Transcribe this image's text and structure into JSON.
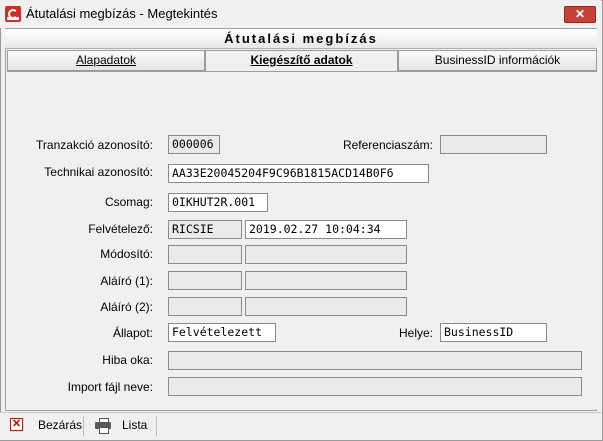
{
  "window": {
    "title": "Átutalási megbízás - Megtekintés",
    "close_glyph": "✕"
  },
  "form": {
    "title": "Átutalási megbízás"
  },
  "tabs": [
    {
      "label": "Alapadatok",
      "active": false
    },
    {
      "label": "Kiegészítő adatok",
      "active": true
    },
    {
      "label": "BusinessID információk",
      "active": false
    }
  ],
  "fields": {
    "tranzakcio": {
      "label": "Tranzakció azonosító:",
      "value": "000006"
    },
    "referencia": {
      "label": "Referenciaszám:",
      "value": ""
    },
    "technikai": {
      "label": "Technikai azonosító:",
      "value": "AA33E20045204F9C96B1815ACD14B0F6"
    },
    "csomag": {
      "label": "Csomag:",
      "value": "0IKHUT2R.001"
    },
    "felvetelezo": {
      "label": "Felvételező:",
      "user": "RICSIE",
      "date": "2019.02.27 10:04:34"
    },
    "modosito": {
      "label": "Módosító:",
      "user": "",
      "date": ""
    },
    "alairo1": {
      "label": "Aláíró (1):",
      "user": "",
      "date": ""
    },
    "alairo2": {
      "label": "Aláíró (2):",
      "user": "",
      "date": ""
    },
    "allapot": {
      "label": "Állapot:",
      "value": "Felvételezett"
    },
    "helye": {
      "label": "Helye:",
      "value": "BusinessID"
    },
    "hiba": {
      "label": "Hiba oka:",
      "value": ""
    },
    "import": {
      "label": "Import fájl neve:",
      "value": ""
    }
  },
  "toolbar": {
    "close_label": "Bezárás",
    "list_label": "Lista"
  }
}
